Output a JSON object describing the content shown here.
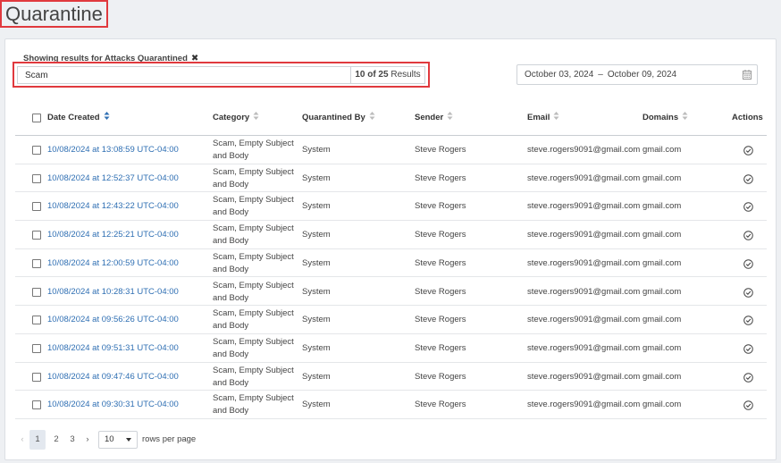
{
  "page": {
    "title": "Quarantine"
  },
  "filter": {
    "label": "Showing results for Attacks Quarantined",
    "clear_glyph": "✖"
  },
  "search": {
    "value": "Scam",
    "results_count": "10 of 25",
    "results_suffix": " Results"
  },
  "date_range": {
    "start": "October 03, 2024",
    "separator": "–",
    "end": "October 09, 2024",
    "icon": "calendar-icon"
  },
  "table": {
    "columns": {
      "date_created": "Date Created",
      "category": "Category",
      "quarantined_by": "Quarantined By",
      "sender": "Sender",
      "email": "Email",
      "domains": "Domains",
      "actions": "Actions"
    },
    "rows": [
      {
        "date": "10/08/2024 at 13:08:59 UTC-04:00",
        "category": "Scam, Empty Subject and Body",
        "quarantined_by": "System",
        "sender": "Steve Rogers",
        "email": "steve.rogers9091@gmail.com",
        "domain": "gmail.com"
      },
      {
        "date": "10/08/2024 at 12:52:37 UTC-04:00",
        "category": "Scam, Empty Subject and Body",
        "quarantined_by": "System",
        "sender": "Steve Rogers",
        "email": "steve.rogers9091@gmail.com",
        "domain": "gmail.com"
      },
      {
        "date": "10/08/2024 at 12:43:22 UTC-04:00",
        "category": "Scam, Empty Subject and Body",
        "quarantined_by": "System",
        "sender": "Steve Rogers",
        "email": "steve.rogers9091@gmail.com",
        "domain": "gmail.com"
      },
      {
        "date": "10/08/2024 at 12:25:21 UTC-04:00",
        "category": "Scam, Empty Subject and Body",
        "quarantined_by": "System",
        "sender": "Steve Rogers",
        "email": "steve.rogers9091@gmail.com",
        "domain": "gmail.com"
      },
      {
        "date": "10/08/2024 at 12:00:59 UTC-04:00",
        "category": "Scam, Empty Subject and Body",
        "quarantined_by": "System",
        "sender": "Steve Rogers",
        "email": "steve.rogers9091@gmail.com",
        "domain": "gmail.com"
      },
      {
        "date": "10/08/2024 at 10:28:31 UTC-04:00",
        "category": "Scam, Empty Subject and Body",
        "quarantined_by": "System",
        "sender": "Steve Rogers",
        "email": "steve.rogers9091@gmail.com",
        "domain": "gmail.com"
      },
      {
        "date": "10/08/2024 at 09:56:26 UTC-04:00",
        "category": "Scam, Empty Subject and Body",
        "quarantined_by": "System",
        "sender": "Steve Rogers",
        "email": "steve.rogers9091@gmail.com",
        "domain": "gmail.com"
      },
      {
        "date": "10/08/2024 at 09:51:31 UTC-04:00",
        "category": "Scam, Empty Subject and Body",
        "quarantined_by": "System",
        "sender": "Steve Rogers",
        "email": "steve.rogers9091@gmail.com",
        "domain": "gmail.com"
      },
      {
        "date": "10/08/2024 at 09:47:46 UTC-04:00",
        "category": "Scam, Empty Subject and Body",
        "quarantined_by": "System",
        "sender": "Steve Rogers",
        "email": "steve.rogers9091@gmail.com",
        "domain": "gmail.com"
      },
      {
        "date": "10/08/2024 at 09:30:31 UTC-04:00",
        "category": "Scam, Empty Subject and Body",
        "quarantined_by": "System",
        "sender": "Steve Rogers",
        "email": "steve.rogers9091@gmail.com",
        "domain": "gmail.com"
      }
    ],
    "row_action_icon": "check-circle-icon"
  },
  "pagination": {
    "prev": "‹",
    "next": "›",
    "pages": [
      "1",
      "2",
      "3"
    ],
    "current_page": "1",
    "rows_per_page_value": "10",
    "rows_per_page_label": "rows per page"
  },
  "colors": {
    "accent_link": "#2f6fb3",
    "highlight_border": "#e0393e"
  }
}
